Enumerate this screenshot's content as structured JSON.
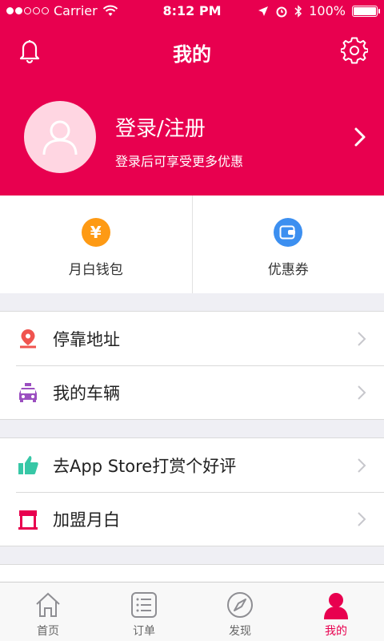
{
  "status": {
    "carrier": "Carrier",
    "time": "8:12 PM",
    "battery": "100%",
    "battery_level": 1.0,
    "signal_bars": 2
  },
  "nav": {
    "title": "我的",
    "left_icon": "bell-icon",
    "right_icon": "gear-icon"
  },
  "profile": {
    "login_label": "登录/注册",
    "subtitle": "登录后可享受更多优惠"
  },
  "wallet": [
    {
      "icon": "yen-icon",
      "glyph": "¥",
      "label": "月白钱包",
      "color": "#fe9a14"
    },
    {
      "icon": "wallet-icon",
      "label": "优惠券",
      "color": "#3c8ff0"
    }
  ],
  "menu_group_1": [
    {
      "icon": "location-pin-icon",
      "label": "停靠地址",
      "color": "#f0544f"
    },
    {
      "icon": "car-icon",
      "label": "我的车辆",
      "color": "#9b4fc0"
    }
  ],
  "menu_group_2": [
    {
      "icon": "thumbs-up-icon",
      "label": "去App Store打赏个好评",
      "color": "#37c7a6"
    },
    {
      "icon": "store-icon",
      "label": "加盟月白",
      "color": "#e8004f"
    }
  ],
  "tabs": [
    {
      "icon": "home-icon",
      "label": "首页",
      "active": false
    },
    {
      "icon": "list-icon",
      "label": "订单",
      "active": false
    },
    {
      "icon": "compass-icon",
      "label": "发现",
      "active": false
    },
    {
      "icon": "person-icon",
      "label": "我的",
      "active": true
    }
  ],
  "colors": {
    "brand": "#e8004f",
    "background": "#efeff4"
  }
}
